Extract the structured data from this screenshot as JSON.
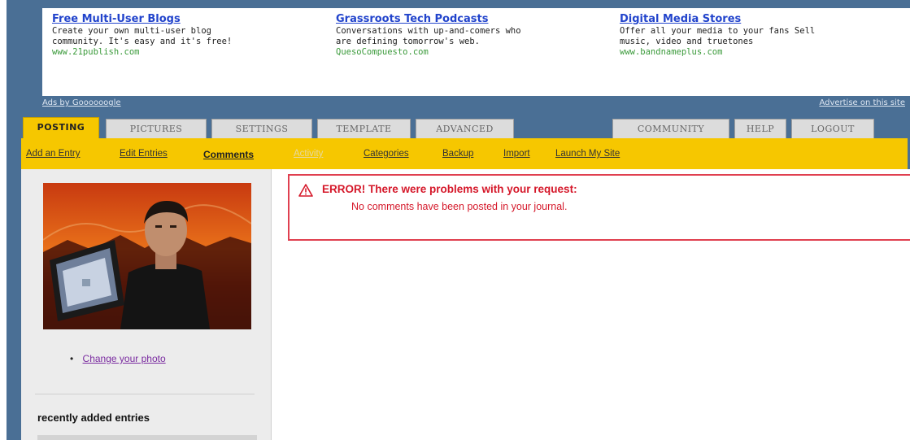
{
  "ads": [
    {
      "title": "Free Multi-User Blogs",
      "desc": "Create your own multi-user blog\ncommunity. It's easy and it's free!",
      "url": "www.21publish.com"
    },
    {
      "title": "Grassroots Tech Podcasts",
      "desc": "Conversations with up-and-comers who\nare defining tomorrow's web.",
      "url": "QuesoCompuesto.com"
    },
    {
      "title": "Digital Media Stores",
      "desc": "Offer all your media to your fans Sell\nmusic, video and truetones",
      "url": "www.bandnameplus.com"
    }
  ],
  "ads_by": "Ads by Goooooogle",
  "advertise": "Advertise on this site",
  "tabs": {
    "posting": "POSTING",
    "pictures": "PICTURES",
    "settings": "SETTINGS",
    "template": "TEMPLATE",
    "advanced": "ADVANCED",
    "community": "COMMUNITY",
    "help": "HELP",
    "logout": "LOGOUT"
  },
  "subnav": {
    "add_entry": "Add an Entry",
    "edit_entries": "Edit Entries",
    "comments": "Comments",
    "activity": "Activity",
    "categories": "Categories",
    "backup": "Backup",
    "import": "Import",
    "launch": "Launch My Site"
  },
  "sidebar": {
    "change_photo": "Change your photo",
    "recent_title": "recently added entries"
  },
  "error": {
    "title": "ERROR! There were problems with your request:",
    "message": "No comments have been posted in your journal."
  },
  "colors": {
    "error": "#d5182a",
    "tab_active": "#f6c700",
    "frame": "#4a6f95"
  }
}
